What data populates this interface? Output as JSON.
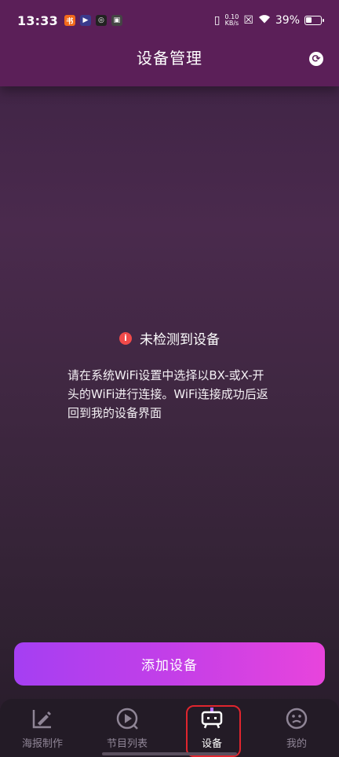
{
  "status_bar": {
    "time": "13:33",
    "net_speed_top": "0.10",
    "net_speed_bottom": "KB/s",
    "battery_percent": "39%"
  },
  "header": {
    "title": "设备管理"
  },
  "notice": {
    "title": "未检测到设备",
    "message": "请在系统WiFi设置中选择以BX-或X-开头的WiFi进行连接。WiFi连接成功后返回到我的设备界面"
  },
  "actions": {
    "add_device_label": "添加设备"
  },
  "tabs": [
    {
      "label": "海报制作",
      "icon": "edit-chart-icon",
      "active": false
    },
    {
      "label": "节目列表",
      "icon": "play-circle-icon",
      "active": false
    },
    {
      "label": "设备",
      "icon": "device-icon",
      "active": true
    },
    {
      "label": "我的",
      "icon": "face-icon",
      "active": false
    }
  ],
  "colors": {
    "header_bg": "#5b1f58",
    "button_gradient_start": "#a53ff2",
    "button_gradient_end": "#e844dc",
    "alert_red": "#f14a4a"
  }
}
